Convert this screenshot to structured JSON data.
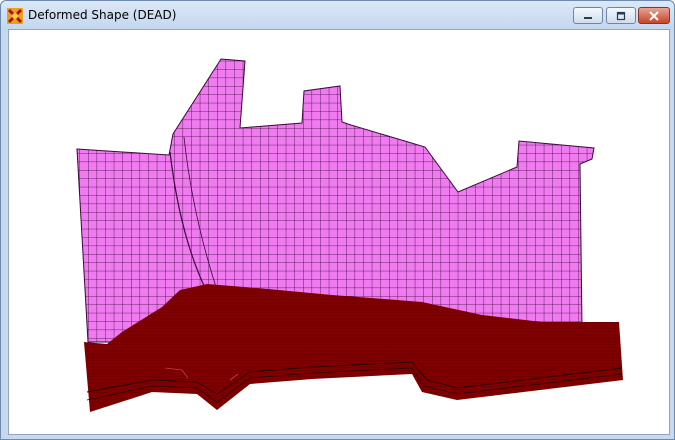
{
  "window": {
    "title": "Deformed Shape (DEAD)",
    "icon": "app-logo-icon",
    "controls": {
      "minimize": "minimize-icon",
      "maximize": "maximize-icon",
      "close": "close-icon"
    }
  },
  "view": {
    "content": "deformed finite element mesh",
    "colors": {
      "mesh_fill": "#f07af0",
      "mesh_lines": "#3a0a3a",
      "solid_fill": "#800000",
      "solid_lines": "#3c0000"
    }
  }
}
